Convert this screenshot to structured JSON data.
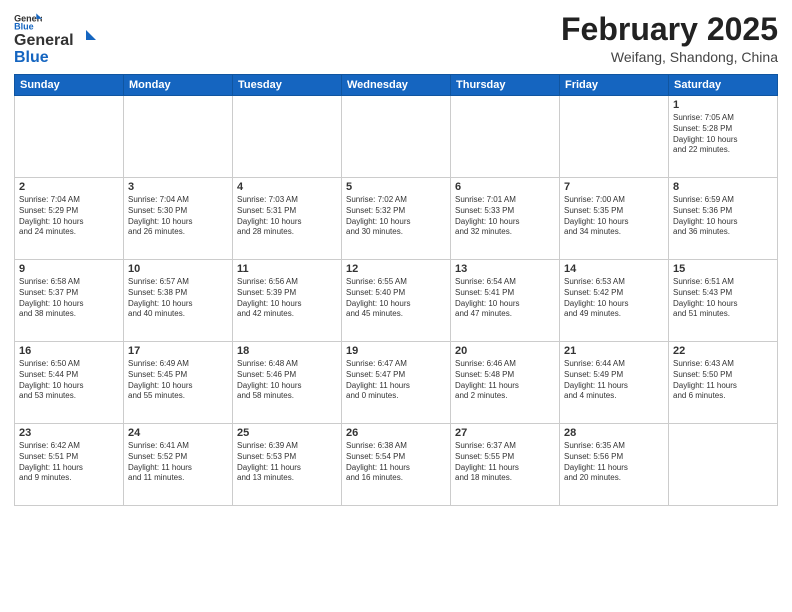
{
  "header": {
    "logo_general": "General",
    "logo_blue": "Blue",
    "month_title": "February 2025",
    "location": "Weifang, Shandong, China"
  },
  "weekdays": [
    "Sunday",
    "Monday",
    "Tuesday",
    "Wednesday",
    "Thursday",
    "Friday",
    "Saturday"
  ],
  "weeks": [
    [
      {
        "day": "",
        "info": ""
      },
      {
        "day": "",
        "info": ""
      },
      {
        "day": "",
        "info": ""
      },
      {
        "day": "",
        "info": ""
      },
      {
        "day": "",
        "info": ""
      },
      {
        "day": "",
        "info": ""
      },
      {
        "day": "1",
        "info": "Sunrise: 7:05 AM\nSunset: 5:28 PM\nDaylight: 10 hours\nand 22 minutes."
      }
    ],
    [
      {
        "day": "2",
        "info": "Sunrise: 7:04 AM\nSunset: 5:29 PM\nDaylight: 10 hours\nand 24 minutes."
      },
      {
        "day": "3",
        "info": "Sunrise: 7:04 AM\nSunset: 5:30 PM\nDaylight: 10 hours\nand 26 minutes."
      },
      {
        "day": "4",
        "info": "Sunrise: 7:03 AM\nSunset: 5:31 PM\nDaylight: 10 hours\nand 28 minutes."
      },
      {
        "day": "5",
        "info": "Sunrise: 7:02 AM\nSunset: 5:32 PM\nDaylight: 10 hours\nand 30 minutes."
      },
      {
        "day": "6",
        "info": "Sunrise: 7:01 AM\nSunset: 5:33 PM\nDaylight: 10 hours\nand 32 minutes."
      },
      {
        "day": "7",
        "info": "Sunrise: 7:00 AM\nSunset: 5:35 PM\nDaylight: 10 hours\nand 34 minutes."
      },
      {
        "day": "8",
        "info": "Sunrise: 6:59 AM\nSunset: 5:36 PM\nDaylight: 10 hours\nand 36 minutes."
      }
    ],
    [
      {
        "day": "9",
        "info": "Sunrise: 6:58 AM\nSunset: 5:37 PM\nDaylight: 10 hours\nand 38 minutes."
      },
      {
        "day": "10",
        "info": "Sunrise: 6:57 AM\nSunset: 5:38 PM\nDaylight: 10 hours\nand 40 minutes."
      },
      {
        "day": "11",
        "info": "Sunrise: 6:56 AM\nSunset: 5:39 PM\nDaylight: 10 hours\nand 42 minutes."
      },
      {
        "day": "12",
        "info": "Sunrise: 6:55 AM\nSunset: 5:40 PM\nDaylight: 10 hours\nand 45 minutes."
      },
      {
        "day": "13",
        "info": "Sunrise: 6:54 AM\nSunset: 5:41 PM\nDaylight: 10 hours\nand 47 minutes."
      },
      {
        "day": "14",
        "info": "Sunrise: 6:53 AM\nSunset: 5:42 PM\nDaylight: 10 hours\nand 49 minutes."
      },
      {
        "day": "15",
        "info": "Sunrise: 6:51 AM\nSunset: 5:43 PM\nDaylight: 10 hours\nand 51 minutes."
      }
    ],
    [
      {
        "day": "16",
        "info": "Sunrise: 6:50 AM\nSunset: 5:44 PM\nDaylight: 10 hours\nand 53 minutes."
      },
      {
        "day": "17",
        "info": "Sunrise: 6:49 AM\nSunset: 5:45 PM\nDaylight: 10 hours\nand 55 minutes."
      },
      {
        "day": "18",
        "info": "Sunrise: 6:48 AM\nSunset: 5:46 PM\nDaylight: 10 hours\nand 58 minutes."
      },
      {
        "day": "19",
        "info": "Sunrise: 6:47 AM\nSunset: 5:47 PM\nDaylight: 11 hours\nand 0 minutes."
      },
      {
        "day": "20",
        "info": "Sunrise: 6:46 AM\nSunset: 5:48 PM\nDaylight: 11 hours\nand 2 minutes."
      },
      {
        "day": "21",
        "info": "Sunrise: 6:44 AM\nSunset: 5:49 PM\nDaylight: 11 hours\nand 4 minutes."
      },
      {
        "day": "22",
        "info": "Sunrise: 6:43 AM\nSunset: 5:50 PM\nDaylight: 11 hours\nand 6 minutes."
      }
    ],
    [
      {
        "day": "23",
        "info": "Sunrise: 6:42 AM\nSunset: 5:51 PM\nDaylight: 11 hours\nand 9 minutes."
      },
      {
        "day": "24",
        "info": "Sunrise: 6:41 AM\nSunset: 5:52 PM\nDaylight: 11 hours\nand 11 minutes."
      },
      {
        "day": "25",
        "info": "Sunrise: 6:39 AM\nSunset: 5:53 PM\nDaylight: 11 hours\nand 13 minutes."
      },
      {
        "day": "26",
        "info": "Sunrise: 6:38 AM\nSunset: 5:54 PM\nDaylight: 11 hours\nand 16 minutes."
      },
      {
        "day": "27",
        "info": "Sunrise: 6:37 AM\nSunset: 5:55 PM\nDaylight: 11 hours\nand 18 minutes."
      },
      {
        "day": "28",
        "info": "Sunrise: 6:35 AM\nSunset: 5:56 PM\nDaylight: 11 hours\nand 20 minutes."
      },
      {
        "day": "",
        "info": ""
      }
    ]
  ]
}
